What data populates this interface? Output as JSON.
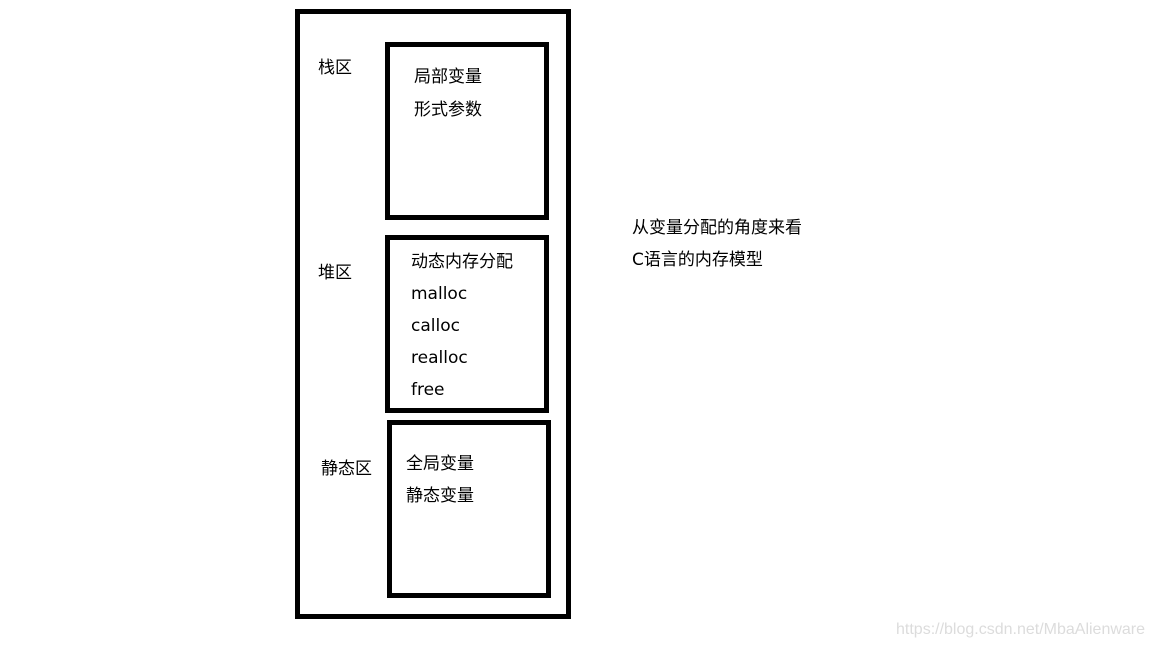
{
  "diagram": {
    "regions": [
      {
        "label": "栈区",
        "items": [
          "局部变量",
          "形式参数"
        ]
      },
      {
        "label": "堆区",
        "items": [
          "动态内存分配",
          "malloc",
          "calloc",
          "realloc",
          "free"
        ]
      },
      {
        "label": "静态区",
        "items": [
          "全局变量",
          "静态变量"
        ]
      }
    ],
    "caption": [
      "从变量分配的角度来看",
      "C语言的内存模型"
    ]
  },
  "watermark": "https://blog.csdn.net/MbaAlienware"
}
